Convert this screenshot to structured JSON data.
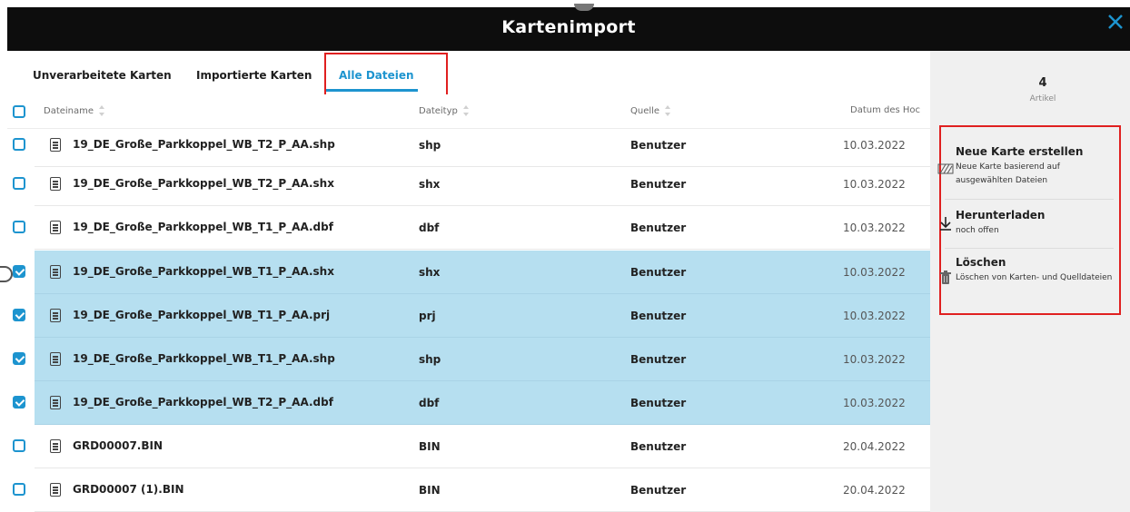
{
  "window": {
    "title": "Kartenimport"
  },
  "tabs": [
    {
      "label": "Unverarbeitete Karten",
      "active": false
    },
    {
      "label": "Importierte Karten",
      "active": false
    },
    {
      "label": "Alle Dateien",
      "active": true
    }
  ],
  "columns": {
    "filename": "Dateiname",
    "filetype": "Dateityp",
    "source": "Quelle",
    "date": "Datum des Hoc"
  },
  "files": [
    {
      "name": "19_DE_Große_Parkkoppel_WB_T2_P_AA.shp",
      "type": "shp",
      "source": "Benutzer",
      "date": "10.03.2022",
      "selected": false
    },
    {
      "name": "19_DE_Große_Parkkoppel_WB_T2_P_AA.shx",
      "type": "shx",
      "source": "Benutzer",
      "date": "10.03.2022",
      "selected": false
    },
    {
      "name": "19_DE_Große_Parkkoppel_WB_T1_P_AA.dbf",
      "type": "dbf",
      "source": "Benutzer",
      "date": "10.03.2022",
      "selected": false
    },
    {
      "name": "19_DE_Große_Parkkoppel_WB_T1_P_AA.shx",
      "type": "shx",
      "source": "Benutzer",
      "date": "10.03.2022",
      "selected": true
    },
    {
      "name": "19_DE_Große_Parkkoppel_WB_T1_P_AA.prj",
      "type": "prj",
      "source": "Benutzer",
      "date": "10.03.2022",
      "selected": true
    },
    {
      "name": "19_DE_Große_Parkkoppel_WB_T1_P_AA.shp",
      "type": "shp",
      "source": "Benutzer",
      "date": "10.03.2022",
      "selected": true
    },
    {
      "name": "19_DE_Große_Parkkoppel_WB_T2_P_AA.dbf",
      "type": "dbf",
      "source": "Benutzer",
      "date": "10.03.2022",
      "selected": true
    },
    {
      "name": "GRD00007.BIN",
      "type": "BIN",
      "source": "Benutzer",
      "date": "20.04.2022",
      "selected": false
    },
    {
      "name": "GRD00007 (1).BIN",
      "type": "BIN",
      "source": "Benutzer",
      "date": "20.04.2022",
      "selected": false
    }
  ],
  "selection": {
    "count": "4",
    "label": "Artikel"
  },
  "actions": {
    "create": {
      "title": "Neue Karte erstellen",
      "desc": "Neue Karte basierend auf ausgewählten Dateien"
    },
    "download": {
      "title": "Herunterladen",
      "desc": "noch offen"
    },
    "delete": {
      "title": "Löschen",
      "desc": "Löschen von Karten- und Quelldateien"
    }
  },
  "colors": {
    "accent": "#1d94cf",
    "selected_row": "#b6dff0",
    "highlight": "#e02020",
    "titlebar": "#0d0d0d"
  }
}
